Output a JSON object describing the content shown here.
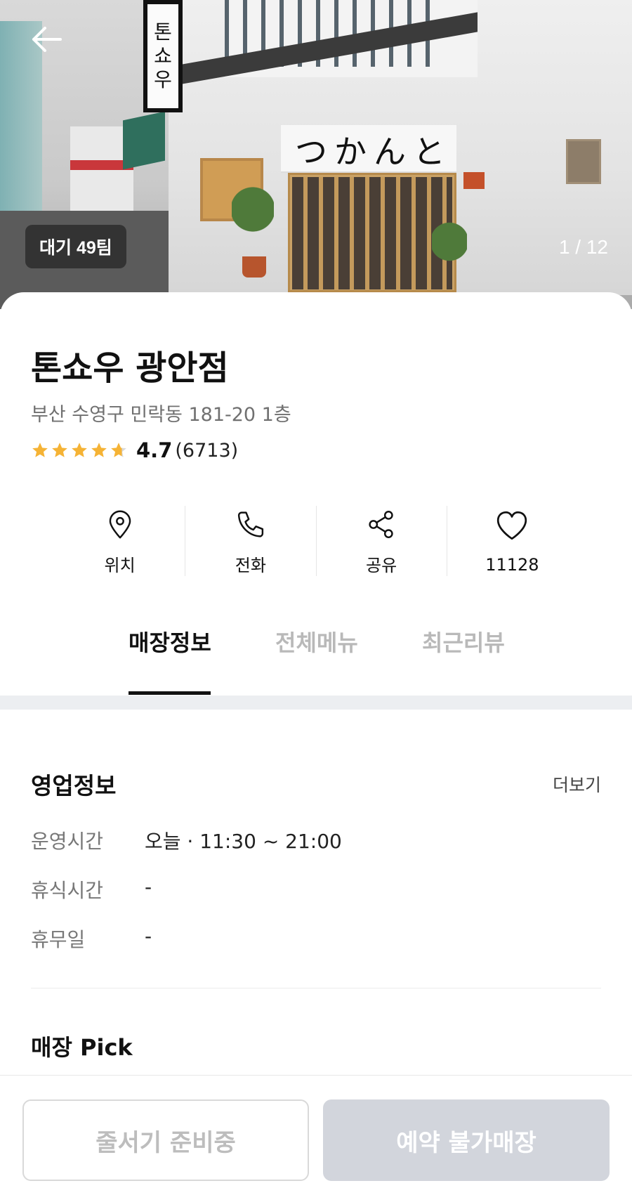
{
  "hero": {
    "signboard_chars": [
      "톤",
      "쇼",
      "우"
    ],
    "noren_text": "つかんと",
    "wait_badge": "대기 49팀",
    "page_counter": "1 / 12"
  },
  "store": {
    "name": "톤쇼우 광안점",
    "address": "부산 수영구 민락동 181-20 1층",
    "rating": "4.7",
    "rating_count": "(6713)",
    "star_color": "#F5B335"
  },
  "actions": {
    "location": "위치",
    "call": "전화",
    "share": "공유",
    "likes": "11128"
  },
  "tabs": {
    "info": "매장정보",
    "menu": "전체메뉴",
    "reviews": "최근리뷰"
  },
  "business": {
    "title": "영업정보",
    "more": "더보기",
    "rows": [
      {
        "label": "운영시간",
        "value": "오늘 · 11:30 ~ 21:00"
      },
      {
        "label": "휴식시간",
        "value": "-"
      },
      {
        "label": "휴무일",
        "value": "-"
      }
    ]
  },
  "pick": {
    "title": "매장 Pick"
  },
  "bottom": {
    "queue_button": "줄서기 준비중",
    "reserve_button": "예약 불가매장"
  }
}
